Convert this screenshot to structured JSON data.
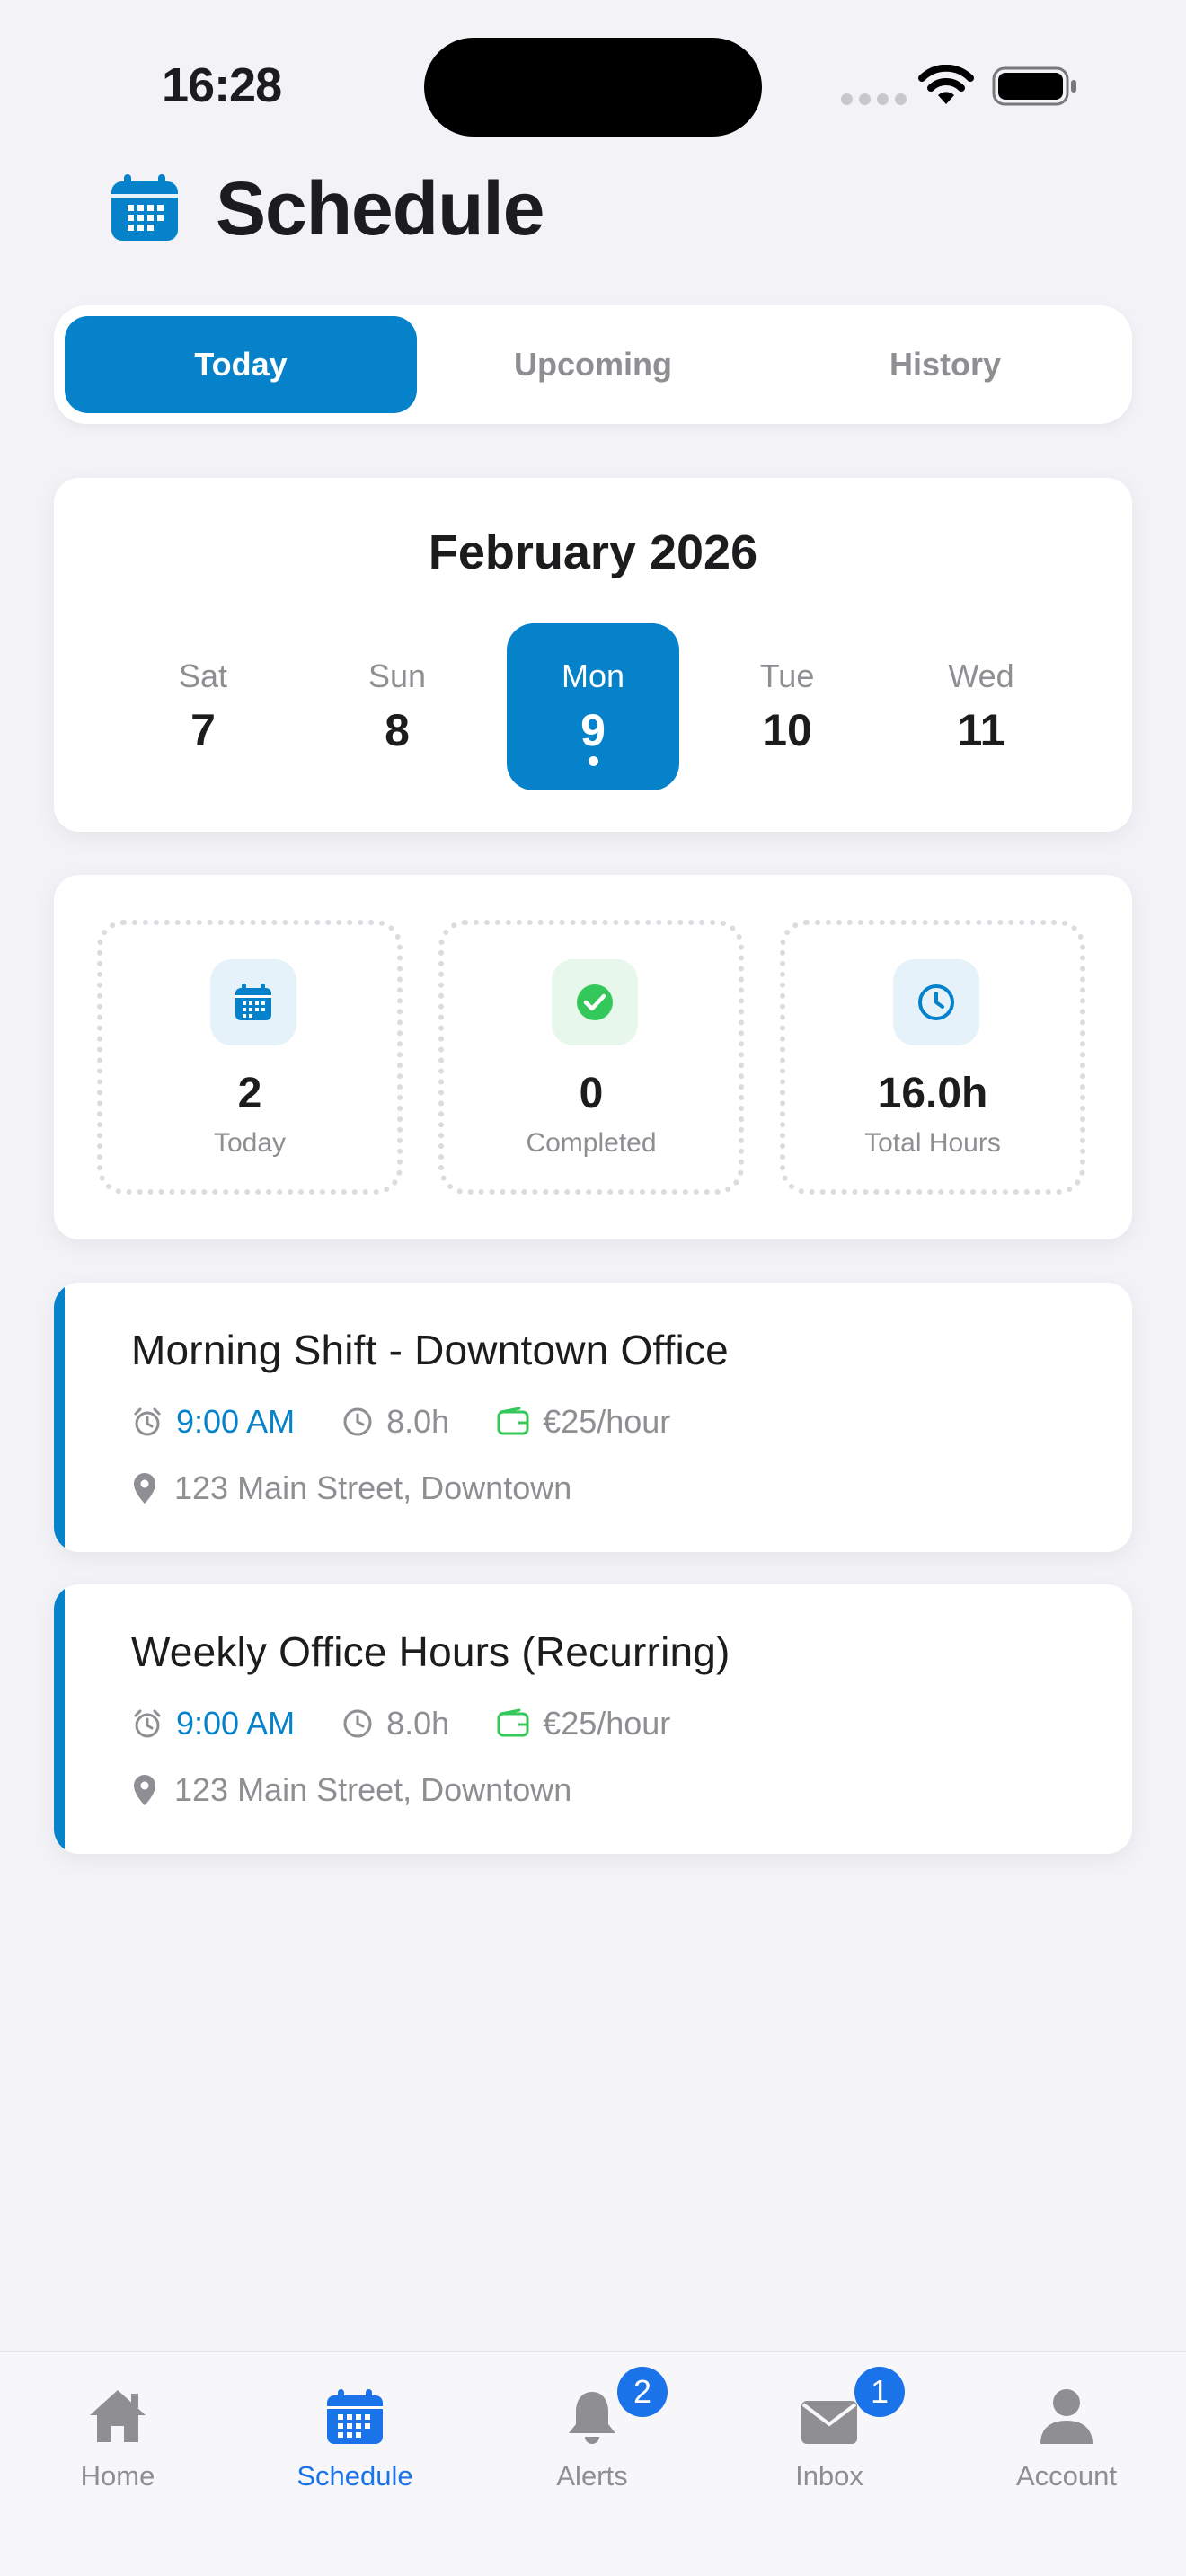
{
  "status_bar": {
    "time": "16:28"
  },
  "header": {
    "title": "Schedule",
    "icon": "calendar-icon",
    "accent": "#0582ca"
  },
  "tabs": [
    {
      "label": "Today",
      "active": true
    },
    {
      "label": "Upcoming",
      "active": false
    },
    {
      "label": "History",
      "active": false
    }
  ],
  "calendar": {
    "month": "February 2026",
    "days": [
      {
        "dow": "Sat",
        "num": "7",
        "selected": false
      },
      {
        "dow": "Sun",
        "num": "8",
        "selected": false
      },
      {
        "dow": "Mon",
        "num": "9",
        "selected": true
      },
      {
        "dow": "Tue",
        "num": "10",
        "selected": false
      },
      {
        "dow": "Wed",
        "num": "11",
        "selected": false
      }
    ]
  },
  "stats": [
    {
      "value": "2",
      "label": "Today",
      "icon": "calendar-icon",
      "color": "#0582ca"
    },
    {
      "value": "0",
      "label": "Completed",
      "icon": "check-circle-icon",
      "color": "#34c759"
    },
    {
      "value": "16.0h",
      "label": "Total Hours",
      "icon": "clock-icon",
      "color": "#0582ca"
    }
  ],
  "shifts": [
    {
      "title": "Morning Shift - Downtown Office",
      "time": "9:00 AM",
      "duration": "8.0h",
      "rate": "€25/hour",
      "location": "123 Main Street, Downtown"
    },
    {
      "title": "Weekly Office Hours (Recurring)",
      "time": "9:00 AM",
      "duration": "8.0h",
      "rate": "€25/hour",
      "location": "123 Main Street, Downtown"
    }
  ],
  "bottom_nav": [
    {
      "label": "Home",
      "icon": "home-icon",
      "active": false
    },
    {
      "label": "Schedule",
      "icon": "calendar-icon",
      "active": true
    },
    {
      "label": "Alerts",
      "icon": "bell-icon",
      "active": false,
      "badge": "2"
    },
    {
      "label": "Inbox",
      "icon": "mail-icon",
      "active": false,
      "badge": "1"
    },
    {
      "label": "Account",
      "icon": "person-icon",
      "active": false
    }
  ]
}
